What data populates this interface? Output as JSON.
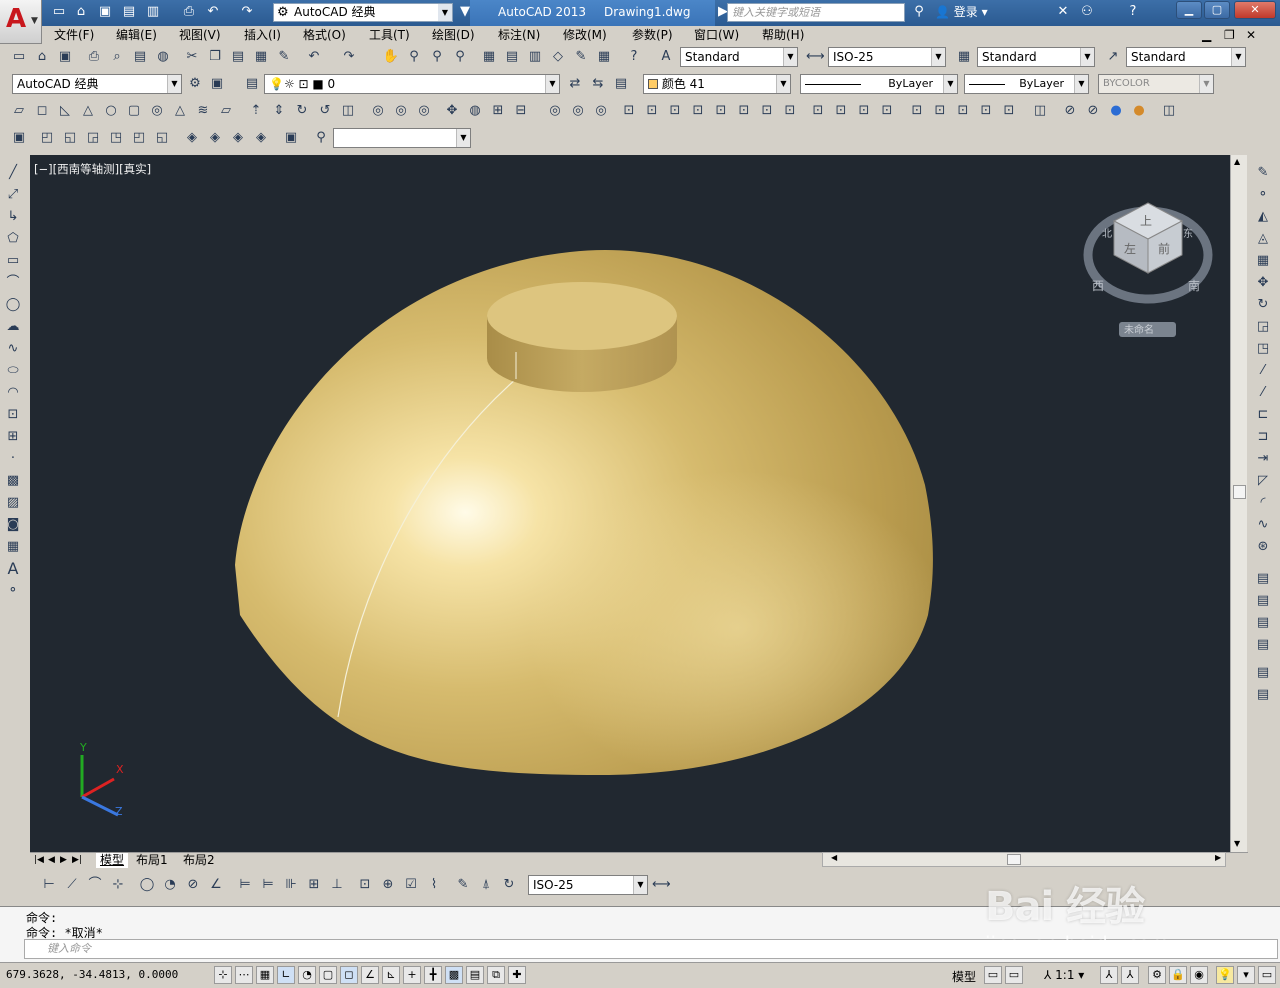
{
  "titlebar": {
    "workspace": "AutoCAD 经典",
    "app_name": "AutoCAD 2013",
    "document": "Drawing1.dwg",
    "search_placeholder": "键入关键字或短语",
    "login": "登录"
  },
  "menubar": {
    "items": [
      "文件(F)",
      "编辑(E)",
      "视图(V)",
      "插入(I)",
      "格式(O)",
      "工具(T)",
      "绘图(D)",
      "标注(N)",
      "修改(M)",
      "参数(P)",
      "窗口(W)",
      "帮助(H)"
    ]
  },
  "styles_toolbar": {
    "text_style": "Standard",
    "dim_style": "ISO-25",
    "table_style": "Standard",
    "mleader_style": "Standard"
  },
  "workspace_toolbar": {
    "workspace": "AutoCAD 经典"
  },
  "layers_toolbar": {
    "layer": "0"
  },
  "properties_toolbar": {
    "color": "颜色 41",
    "linetype": "ByLayer",
    "lineweight": "ByLayer",
    "plotstyle": "BYCOLOR"
  },
  "viewport": {
    "label": "[−][西南等轴测][真实]",
    "viewcube_top": "上",
    "viewcube_left": "左",
    "viewcube_front": "前",
    "compass_north": "北",
    "compass_east": "东",
    "compass_south": "南",
    "compass_west": "西",
    "ucs_name": "未命名",
    "axis_x": "X",
    "axis_y": "Y",
    "axis_z": "Z"
  },
  "colors": {
    "viewport_bg": "#212830",
    "model_gold": "#c9ae5f",
    "title_blue": "#3a74b8"
  },
  "tabs": {
    "model": "模型",
    "layout1": "布局1",
    "layout2": "布局2"
  },
  "dim_toolbar": {
    "dim_style": "ISO-25"
  },
  "command": {
    "line1": "命令:",
    "line2": "命令: *取消*",
    "input_placeholder": "键入命令"
  },
  "statusbar": {
    "coords": "679.3628, -34.4813, 0.0000",
    "model": "模型",
    "scale": "1:1"
  },
  "watermark": {
    "brand": "Bai 经验",
    "url": "jingyan.baidu.com"
  }
}
